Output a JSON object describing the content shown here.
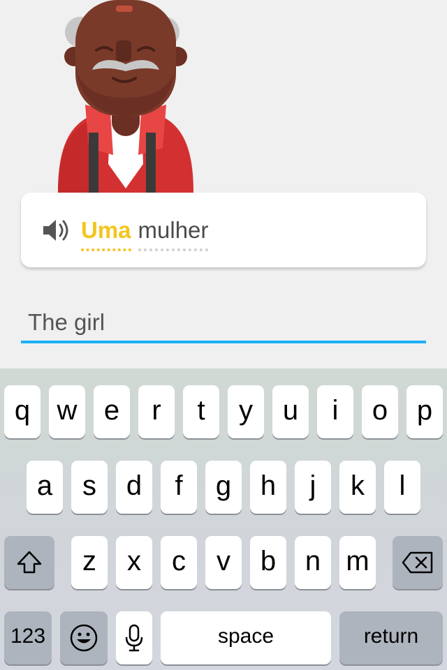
{
  "prompt": {
    "words": [
      {
        "text": "Uma",
        "highlighted": true
      },
      {
        "text": "mulher",
        "highlighted": false
      }
    ],
    "speaker_icon": "speaker-icon"
  },
  "answer": {
    "value": "The girl"
  },
  "keyboard": {
    "row1": [
      "q",
      "w",
      "e",
      "r",
      "t",
      "y",
      "u",
      "i",
      "o",
      "p"
    ],
    "row2": [
      "a",
      "s",
      "d",
      "f",
      "g",
      "h",
      "j",
      "k",
      "l"
    ],
    "row3": [
      "z",
      "x",
      "c",
      "v",
      "b",
      "n",
      "m"
    ],
    "shift_icon": "shift-icon",
    "delete_icon": "backspace-icon",
    "numbers_label": "123",
    "emoji_icon": "emoji-icon",
    "mic_icon": "microphone-icon",
    "space_label": "space",
    "return_label": "return"
  },
  "colors": {
    "accent_blue": "#1cb0f6",
    "highlight_yellow": "#f4c51c",
    "shirt_red": "#d33131"
  }
}
